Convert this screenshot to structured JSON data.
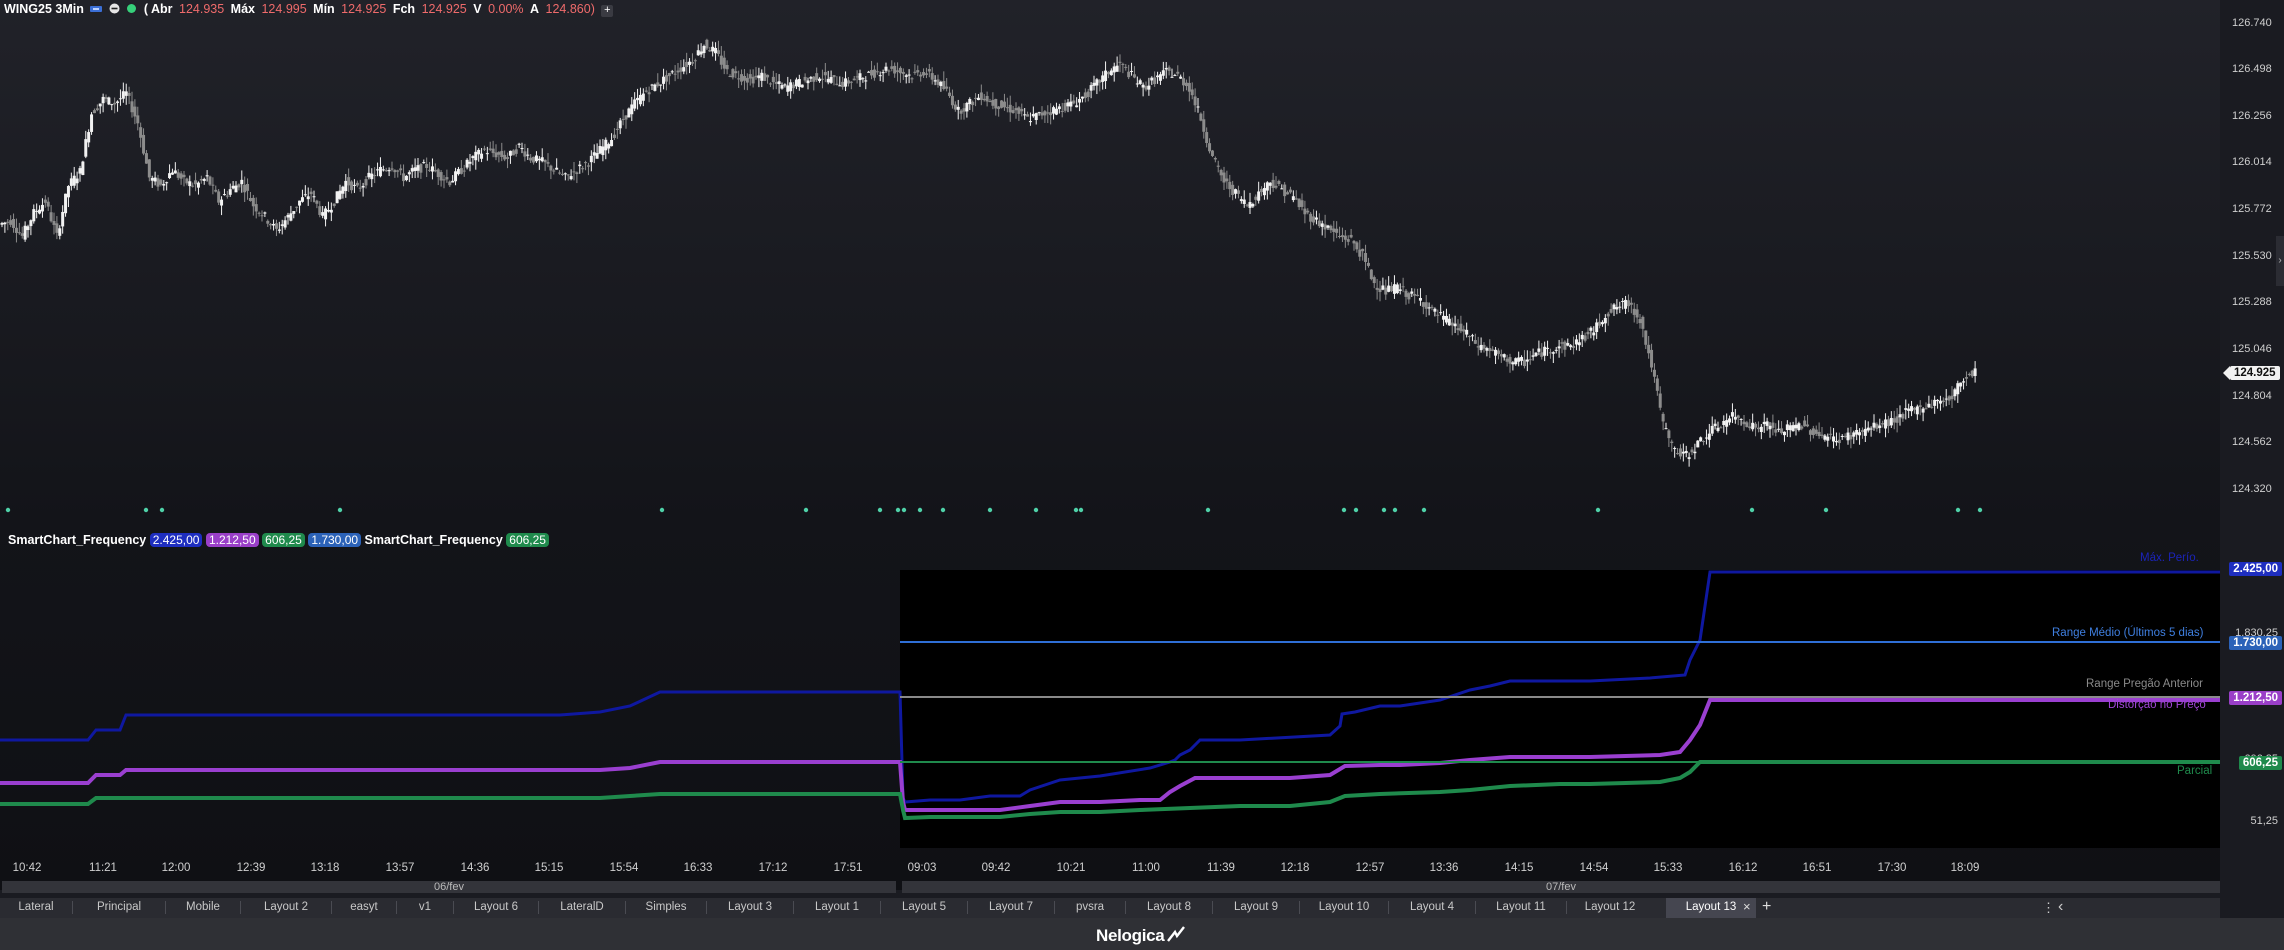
{
  "header": {
    "symbol": "WING25 3Min",
    "paren": "(",
    "abr_label": "Abr",
    "abr": "124.935",
    "max_label": "Máx",
    "max": "124.995",
    "min_label": "Mín",
    "min": "124.925",
    "fch_label": "Fch",
    "fch": "124.925",
    "v_label": "V",
    "v": "0.00%",
    "a_label": "A",
    "a": "124.860)",
    "plus": "+"
  },
  "price_axis": {
    "ticks": [
      "126.740",
      "126.498",
      "126.256",
      "126.014",
      "125.772",
      "125.530",
      "125.288",
      "125.046",
      "124.804",
      "124.562",
      "124.320"
    ],
    "current": "124.925"
  },
  "indicator": {
    "name1": "SmartChart_Frequency",
    "badges": [
      {
        "text": "2.425,00",
        "color": "#1e2ec0"
      },
      {
        "text": "1.212,50",
        "color": "#9a3fc8"
      },
      {
        "text": "606,25",
        "color": "#1f8a4c"
      },
      {
        "text": "1.730,00",
        "color": "#2b62b8"
      }
    ],
    "name2": "SmartChart_Frequency",
    "badge2": {
      "text": "606,25",
      "color": "#1f8a4c"
    },
    "labels": {
      "max_period": "Máx. Perío.",
      "range_medio": "Range Médio (Últimos 5 dias)",
      "range_pregao": "Range Pregão Anterior",
      "distorcao": "Distorção no Preço",
      "parcial": "Parcial"
    },
    "axis": {
      "tag_top": "2.425,00",
      "tick_1830": "1.830,25",
      "tag_1730": "1.730,00",
      "tag_1212": "1.212,50",
      "tick_606": "606,25",
      "tag_606": "606,25",
      "tick_51": "51,25"
    },
    "colors": {
      "navy": "#0f18a0",
      "purple": "#9a3fd0",
      "green": "#1f8a4c",
      "blue": "#2f6fd6",
      "gray": "#8a8a8a"
    }
  },
  "time_axis": [
    "10:42",
    "11:21",
    "12:00",
    "12:39",
    "13:18",
    "13:57",
    "14:36",
    "15:15",
    "15:54",
    "16:33",
    "17:12",
    "17:51",
    "09:03",
    "09:42",
    "10:21",
    "11:00",
    "11:39",
    "12:18",
    "12:57",
    "13:36",
    "14:15",
    "14:54",
    "15:33",
    "16:12",
    "16:51",
    "17:30",
    "18:09"
  ],
  "dates": [
    "06/fev",
    "07/fev"
  ],
  "tabs": [
    "Lateral",
    "Principal",
    "Mobile",
    "Layout 2",
    "easyt",
    "v1",
    "Layout 6",
    "LateralD",
    "Simples",
    "Layout 3",
    "Layout 1",
    "Layout 5",
    "Layout 7",
    "pvsra",
    "Layout 8",
    "Layout 9",
    "Layout 10",
    "Layout 4",
    "Layout 11",
    "Layout 12",
    "Layout 13"
  ],
  "active_tab": "Layout 13",
  "tab_close": "×",
  "tab_add": "+",
  "menu_dots": "⋮",
  "collapse": "‹",
  "brand": "Nelogica",
  "candles": {
    "series": [
      125.68,
      125.7,
      125.62,
      125.74,
      125.8,
      125.62,
      125.88,
      125.95,
      126.25,
      126.32,
      126.3,
      126.35,
      126.2,
      125.92,
      125.88,
      125.96,
      125.9,
      125.88,
      125.92,
      125.8,
      125.86,
      125.9,
      125.78,
      125.72,
      125.65,
      125.72,
      125.8,
      125.84,
      125.72,
      125.8,
      125.9,
      125.86,
      125.92,
      125.96,
      125.98,
      125.92,
      125.96,
      125.98,
      125.94,
      125.9,
      125.96,
      126.02,
      126.06,
      126.04,
      126.02,
      126.08,
      126.02,
      126.0,
      125.96,
      125.92,
      125.96,
      126.0,
      126.06,
      126.12,
      126.22,
      126.3,
      126.36,
      126.4,
      126.44,
      126.48,
      126.52,
      126.6,
      126.56,
      126.46,
      126.44,
      126.42,
      126.44,
      126.4,
      126.38,
      126.4,
      126.42,
      126.44,
      126.42,
      126.4,
      126.42,
      126.44,
      126.46,
      126.48,
      126.46,
      126.44,
      126.46,
      126.42,
      126.36,
      126.26,
      126.3,
      126.34,
      126.3,
      126.28,
      126.26,
      126.22,
      126.24,
      126.26,
      126.28,
      126.3,
      126.34,
      126.4,
      126.46,
      126.5,
      126.44,
      126.38,
      126.42,
      126.46,
      126.44,
      126.38,
      126.22,
      126.02,
      125.9,
      125.84,
      125.78,
      125.84,
      125.9,
      125.86,
      125.82,
      125.74,
      125.7,
      125.66,
      125.62,
      125.6,
      125.52,
      125.38,
      125.34,
      125.36,
      125.32,
      125.3,
      125.24,
      125.2,
      125.16,
      125.12,
      125.06,
      125.04,
      125.0,
      124.98,
      124.98,
      125.02,
      125.04,
      125.06,
      125.06,
      125.1,
      125.14,
      125.22,
      125.26,
      125.28,
      125.2,
      124.96,
      124.66,
      124.52,
      124.5,
      124.56,
      124.62,
      124.66,
      124.7,
      124.68,
      124.64,
      124.66,
      124.62,
      124.64,
      124.66,
      124.62,
      124.6,
      124.58,
      124.6,
      124.62,
      124.64,
      124.66,
      124.68,
      124.72,
      124.74,
      124.76,
      124.78,
      124.8,
      124.9,
      124.93
    ]
  }
}
